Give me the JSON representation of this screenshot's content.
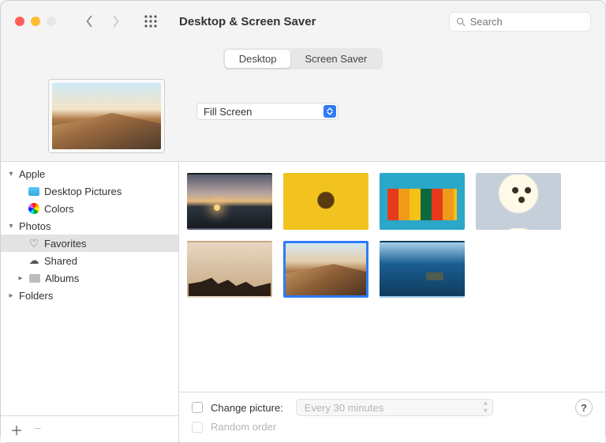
{
  "window": {
    "title": "Desktop & Screen Saver"
  },
  "search": {
    "placeholder": "Search"
  },
  "tabs": {
    "desktop": "Desktop",
    "screensaver": "Screen Saver",
    "active": "desktop"
  },
  "fill_mode": {
    "label": "Fill Screen"
  },
  "sidebar": {
    "groups": [
      {
        "id": "apple",
        "label": "Apple",
        "expanded": true,
        "children": [
          {
            "id": "desktop-pictures",
            "label": "Desktop Pictures",
            "icon": "folder-blue"
          },
          {
            "id": "colors",
            "label": "Colors",
            "icon": "colors"
          }
        ]
      },
      {
        "id": "photos",
        "label": "Photos",
        "expanded": true,
        "children": [
          {
            "id": "favorites",
            "label": "Favorites",
            "icon": "heart",
            "selected": true
          },
          {
            "id": "shared",
            "label": "Shared",
            "icon": "cloud"
          },
          {
            "id": "albums",
            "label": "Albums",
            "icon": "folder-gray",
            "disclosure": true
          }
        ]
      },
      {
        "id": "folders",
        "label": "Folders",
        "expanded": false,
        "children": []
      }
    ]
  },
  "gallery": {
    "selected_index": 5
  },
  "footer": {
    "change_picture_label": "Change picture:",
    "random_order_label": "Random order",
    "interval_label": "Every 30 minutes",
    "change_picture_checked": false,
    "random_order_enabled": false,
    "help_label": "?"
  }
}
